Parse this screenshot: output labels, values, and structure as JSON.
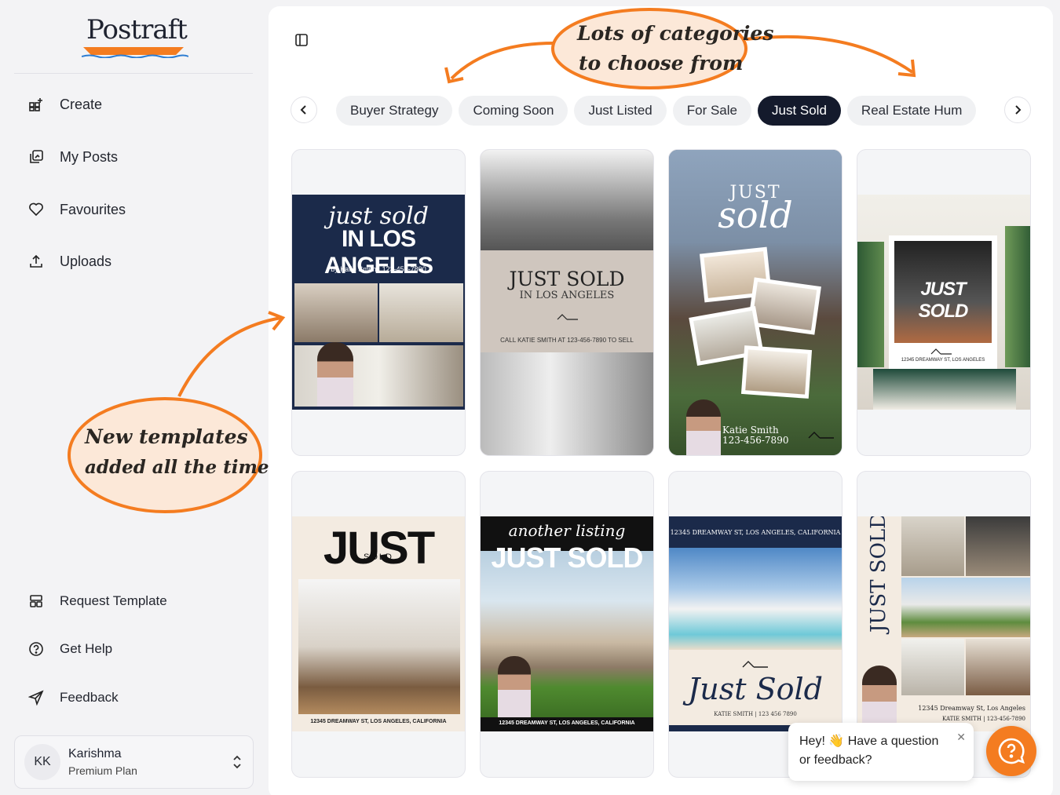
{
  "app": {
    "logo_text": "Postraft"
  },
  "sidebar": {
    "nav": [
      {
        "label": "Create",
        "icon": "grid-plus-icon"
      },
      {
        "label": "My Posts",
        "icon": "posts-icon"
      },
      {
        "label": "Favourites",
        "icon": "heart-icon"
      },
      {
        "label": "Uploads",
        "icon": "upload-icon"
      }
    ],
    "footer_nav": [
      {
        "label": "Request Template",
        "icon": "template-icon"
      },
      {
        "label": "Get Help",
        "icon": "help-circle-icon"
      },
      {
        "label": "Feedback",
        "icon": "send-icon"
      }
    ],
    "user": {
      "initials": "KK",
      "name": "Karishma",
      "plan": "Premium Plan"
    }
  },
  "categories": {
    "items": [
      "Buyer Strategy",
      "Coming Soon",
      "Just Listed",
      "For Sale",
      "Just Sold",
      "Real Estate Hum"
    ],
    "active": "Just Sold"
  },
  "templates": [
    {
      "line1": "just sold",
      "line2": "IN LOS ANGELES",
      "line3": "by Katie Smith  |  123-456-7890"
    },
    {
      "line1": "JUST SOLD",
      "line2": "IN LOS ANGELES",
      "line3": "CALL KATIE SMITH AT 123-456-7890 TO SELL"
    },
    {
      "line1": "JUST",
      "line2": "sold",
      "line3": "Katie Smith",
      "line4": "123-456-7890"
    },
    {
      "line1": "JUST SOLD",
      "line2": "12345 DREAMWAY ST, LOS ANGELES"
    },
    {
      "line1": "JUST",
      "line2": "SOLD",
      "line3": "12345 DREAMWAY ST, LOS ANGELES, CALIFORNIA"
    },
    {
      "line1": "another listing",
      "line2": "JUST SOLD",
      "line3": "12345 DREAMWAY ST, LOS ANGELES, CALIFORNIA"
    },
    {
      "line1": "12345 DREAMWAY ST, LOS ANGELES, CALIFORNIA",
      "line2": "Just Sold",
      "line3": "KATIE SMITH  |  123 456 7890"
    },
    {
      "line1": "JUST SOLD",
      "line2": "12345 Dreamway St, Los Angeles",
      "line3": "KATIE SMITH  |  123-456-7890"
    }
  ],
  "annotations": {
    "top_line1": "Lots of categories",
    "top_line2": "to choose from",
    "left_line1": "New templates",
    "left_line2": "added all the time"
  },
  "help_widget": {
    "message": "Hey! 👋 Have a question or feedback?"
  },
  "colors": {
    "accent": "#f47c20",
    "navy": "#141a2c",
    "annotation_fill": "#fce8d8"
  }
}
